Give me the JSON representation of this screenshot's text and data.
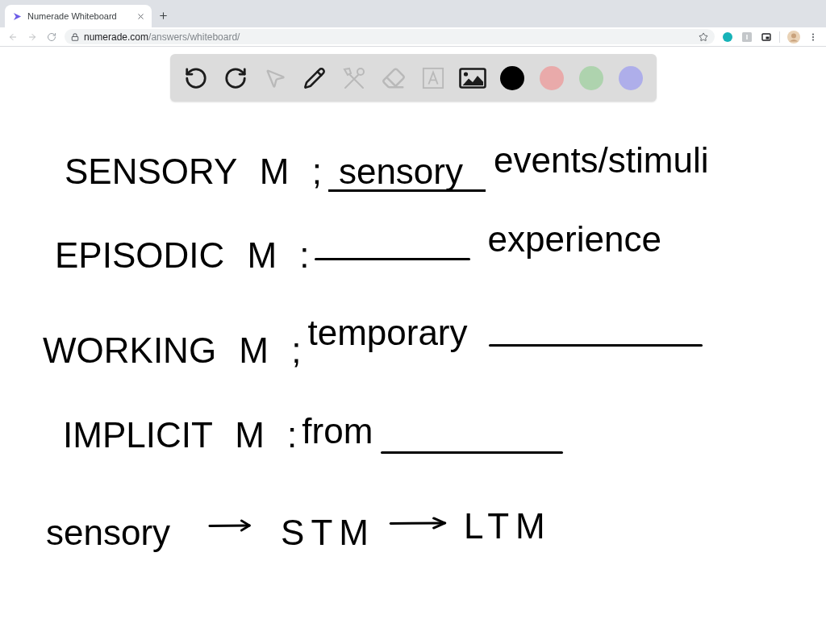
{
  "browser": {
    "tab": {
      "title": "Numerade Whiteboard"
    },
    "url": {
      "host": "numerade.com",
      "path": "/answers/whiteboard/"
    }
  },
  "toolbar": {
    "tools": [
      {
        "kind": "undo",
        "disabled": false
      },
      {
        "kind": "redo",
        "disabled": false
      },
      {
        "kind": "select",
        "disabled": true
      },
      {
        "kind": "pen",
        "disabled": false
      },
      {
        "kind": "shapes",
        "disabled": true
      },
      {
        "kind": "eraser",
        "disabled": true
      },
      {
        "kind": "text",
        "disabled": true
      },
      {
        "kind": "image",
        "disabled": false
      }
    ],
    "colors": [
      {
        "color": "#000000"
      },
      {
        "color": "#e9aaaa"
      },
      {
        "color": "#aed3ae"
      },
      {
        "color": "#aeaeea"
      }
    ]
  },
  "whiteboard": {
    "lines": [
      {
        "segments": [
          {
            "kind": "text",
            "text": "SENSORY M ;",
            "underlined": false
          },
          {
            "kind": "text",
            "text": "sensory",
            "underlined": true
          },
          {
            "kind": "text",
            "text": "events/stimuli",
            "underlined": false
          }
        ]
      },
      {
        "segments": [
          {
            "kind": "text",
            "text": "EPISODIC M :",
            "underlined": false
          },
          {
            "kind": "blank"
          },
          {
            "kind": "text",
            "text": "experience",
            "underlined": false
          }
        ]
      },
      {
        "segments": [
          {
            "kind": "text",
            "text": "WORKING M ;",
            "underlined": false
          },
          {
            "kind": "text",
            "text": "temporary",
            "underlined": false
          },
          {
            "kind": "blank"
          }
        ]
      },
      {
        "segments": [
          {
            "kind": "text",
            "text": "IMPLICIT M :",
            "underlined": false
          },
          {
            "kind": "text",
            "text": "from",
            "underlined": false
          },
          {
            "kind": "blank"
          }
        ]
      },
      {
        "segments": [
          {
            "kind": "text",
            "text": "sensory",
            "underlined": false
          },
          {
            "kind": "arrow"
          },
          {
            "kind": "text",
            "text": "STM",
            "underlined": false
          },
          {
            "kind": "arrow"
          },
          {
            "kind": "text",
            "text": "LTM",
            "underlined": false
          }
        ]
      }
    ]
  }
}
